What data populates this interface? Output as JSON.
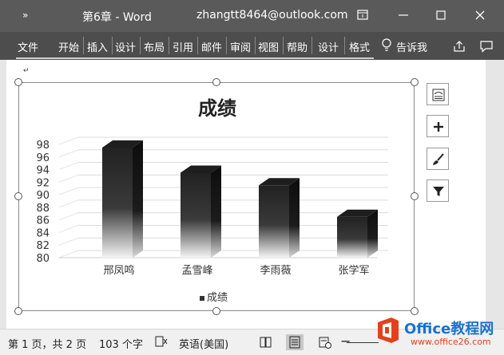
{
  "titlebar": {
    "qat_symbol": "»",
    "doc_title": "第6章  -  Word",
    "account": "zhangtt8464@outlook.com"
  },
  "ribbon": {
    "tabs": [
      "文件",
      "开始",
      "插入",
      "设计",
      "布局",
      "引用",
      "邮件",
      "审阅",
      "视图",
      "帮助",
      "设计",
      "格式"
    ],
    "tell_me": "告诉我"
  },
  "document": {
    "paragraph_mark": "↵"
  },
  "chart_data": {
    "type": "bar",
    "title": "成绩",
    "categories": [
      "邢凤鸣",
      "孟雪峰",
      "李雨薇",
      "张学军"
    ],
    "series": [
      {
        "name": "成绩",
        "values": [
          97.5,
          93.5,
          91.5,
          86.5
        ]
      }
    ],
    "ylim": [
      80,
      98
    ],
    "yticks": [
      "98",
      "96",
      "94",
      "92",
      "90",
      "88",
      "86",
      "84",
      "82",
      "80"
    ],
    "grid": true,
    "legend_position": "bottom"
  },
  "statusbar": {
    "page_info": "第 1 页，共 2 页",
    "word_count": "103 个字",
    "language": "英语(美国)"
  },
  "watermark": {
    "brand": "Office教程网",
    "url": "www.office26.com"
  },
  "colors": {
    "titlebar_bg": "#5a5a5a",
    "ribbon_bg": "#4d4d4d",
    "bar_top": "#1e1e1e"
  }
}
